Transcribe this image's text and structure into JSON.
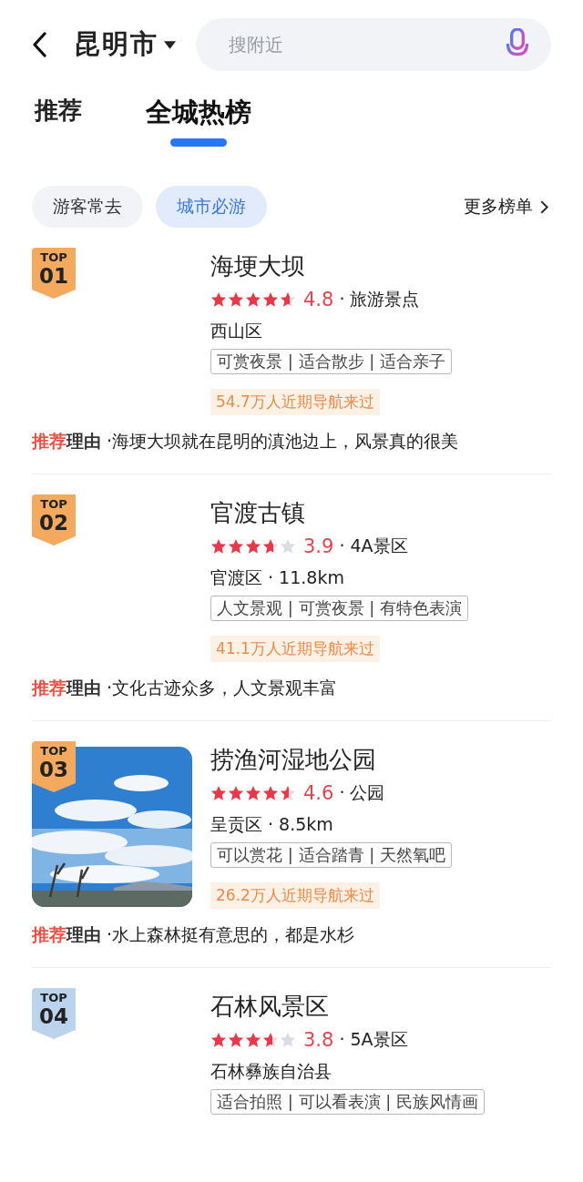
{
  "header": {
    "city": "昆明市",
    "search": {
      "placeholder": "搜附近"
    }
  },
  "tabs": [
    {
      "label": "推荐",
      "selected": false
    },
    {
      "label": "全城热榜",
      "selected": true
    }
  ],
  "filters": [
    {
      "label": "游客常去",
      "selected": false
    },
    {
      "label": "城市必游",
      "selected": true
    }
  ],
  "more_lists": "更多榜单",
  "items": [
    {
      "badge": {
        "top": "TOP",
        "rank": "01",
        "color": "#f3a95e"
      },
      "name": "海埂大坝",
      "stars": 4.8,
      "rating": "4.8",
      "category": "· 旅游景点",
      "location": "西山区",
      "tags": "可赏夜景 | 适合散步 | 适合亲子",
      "visits": "54.7万人近期导航来过",
      "reason_accent": "推荐",
      "reason_label": "理由",
      "reason": "·海埂大坝就在昆明的滇池边上，风景真的很美"
    },
    {
      "badge": {
        "top": "TOP",
        "rank": "02",
        "color": "#f3a95e"
      },
      "name": "官渡古镇",
      "stars": 3.9,
      "rating": "3.9",
      "category": "· 4A景区",
      "location": "官渡区 · 11.8km",
      "tags": "人文景观 | 可赏夜景 | 有特色表演",
      "visits": "41.1万人近期导航来过",
      "reason_accent": "推荐",
      "reason_label": "理由",
      "reason": "·文化古迹众多，人文景观丰富"
    },
    {
      "badge": {
        "top": "TOP",
        "rank": "03",
        "color": "#f3a95e"
      },
      "name": "捞渔河湿地公园",
      "stars": 4.6,
      "rating": "4.6",
      "category": "· 公园",
      "location": "呈贡区 · 8.5km",
      "tags": "可以赏花 | 适合踏青 | 天然氧吧",
      "visits": "26.2万人近期导航来过",
      "reason_accent": "推荐",
      "reason_label": "理由",
      "reason": "·水上森林挺有意思的，都是水杉"
    },
    {
      "badge": {
        "top": "TOP",
        "rank": "04",
        "color": "#bcd3ee"
      },
      "name": "石林风景区",
      "stars": 3.8,
      "rating": "3.8",
      "category": "· 5A景区",
      "location": "石林彝族自治县",
      "tags": "适合拍照 | 可以看表演 | 民族风情画"
    }
  ]
}
